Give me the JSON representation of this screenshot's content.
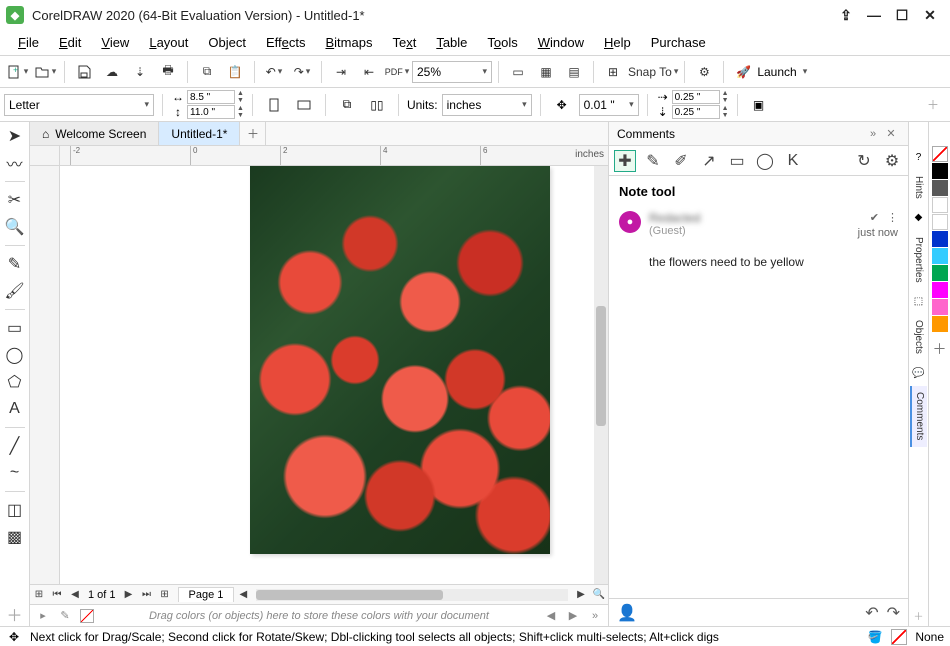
{
  "window": {
    "title": "CorelDRAW 2020 (64-Bit Evaluation Version) - Untitled-1*"
  },
  "menu": {
    "file": "File",
    "edit": "Edit",
    "view": "View",
    "layout": "Layout",
    "object": "Object",
    "effects": "Effects",
    "bitmaps": "Bitmaps",
    "text": "Text",
    "table": "Table",
    "tools": "Tools",
    "window": "Window",
    "help": "Help",
    "purchase": "Purchase"
  },
  "toolbar1": {
    "zoom": "25%",
    "snap_to": "Snap To",
    "launch": "Launch"
  },
  "propbar": {
    "page_preset": "Letter",
    "width": "8.5 \"",
    "height": "11.0 \"",
    "units_label": "Units:",
    "units_value": "inches",
    "nudge": "0.01 \"",
    "dup_x": "0.25 \"",
    "dup_y": "0.25 \""
  },
  "doctabs": {
    "welcome": "Welcome Screen",
    "doc1": "Untitled-1*"
  },
  "ruler": {
    "units": "inches",
    "ticks": [
      "-2",
      "0",
      "2",
      "4",
      "6"
    ]
  },
  "pagenav": {
    "counter": "1 of 1",
    "page_tab": "Page 1"
  },
  "colortray": {
    "hint": "Drag colors (or objects) here to store these colors with your document"
  },
  "comments": {
    "title": "Comments",
    "note_tool": "Note tool",
    "author": "Redacted",
    "guest": "(Guest)",
    "time": "just now",
    "text": "the flowers need to be yellow"
  },
  "rightdock": {
    "hints": "Hints",
    "properties": "Properties",
    "objects": "Objects",
    "comments": "Comments"
  },
  "color_swatches": [
    "#000000",
    "#595959",
    "#ffffff",
    "#e6e6e6",
    "#ffffff",
    "#0033cc",
    "#33ccff",
    "#00a651",
    "#ff00ff",
    "#ff66cc",
    "#ff9900"
  ],
  "statusbar": {
    "msg": "Next click for Drag/Scale; Second click for Rotate/Skew; Dbl-clicking tool selects all objects; Shift+click multi-selects; Alt+click digs",
    "fill": "None"
  }
}
